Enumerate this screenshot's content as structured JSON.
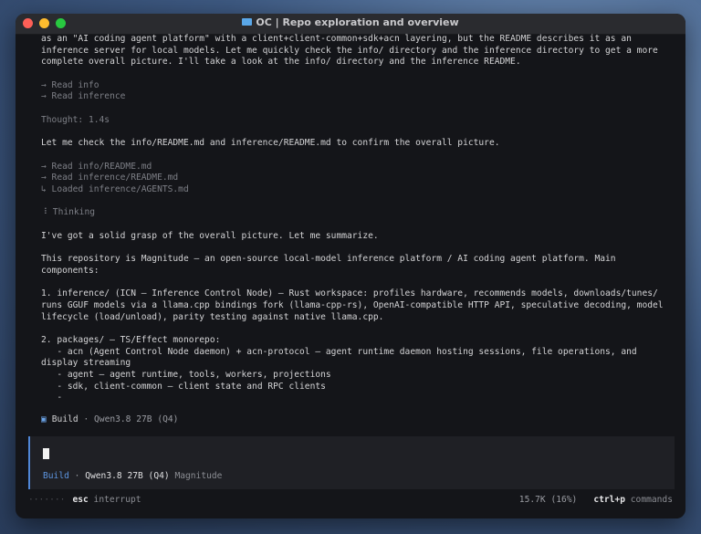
{
  "window": {
    "title": "OC | Repo exploration and overview"
  },
  "transcript": [
    {
      "text": "as an \"AI coding agent platform\" with a client+client-common+sdk+acn layering, but the README describes it as an",
      "style": "normal"
    },
    {
      "text": "inference server for local models. Let me quickly check the info/ directory and the inference directory to get a more",
      "style": "normal"
    },
    {
      "text": "complete overall picture. I'll take a look at the info/ directory and the inference README.",
      "style": "normal"
    },
    {
      "text": "",
      "style": "blank"
    },
    {
      "text": "→ Read info",
      "style": "dim"
    },
    {
      "text": "→ Read inference",
      "style": "dim"
    },
    {
      "text": "",
      "style": "blank"
    },
    {
      "text": "Thought: 1.4s",
      "style": "dim"
    },
    {
      "text": "",
      "style": "blank"
    },
    {
      "text": "Let me check the info/README.md and inference/README.md to confirm the overall picture.",
      "style": "normal"
    },
    {
      "text": "",
      "style": "blank"
    },
    {
      "text": "→ Read info/README.md",
      "style": "dim"
    },
    {
      "text": "→ Read inference/README.md",
      "style": "dim"
    },
    {
      "text": "↳ Loaded inference/AGENTS.md",
      "style": "dim"
    },
    {
      "text": "",
      "style": "blank"
    },
    {
      "text": "⠸ Thinking",
      "style": "dim"
    },
    {
      "text": "",
      "style": "blank"
    },
    {
      "text": "I've got a solid grasp of the overall picture. Let me summarize.",
      "style": "normal"
    },
    {
      "text": "",
      "style": "blank"
    },
    {
      "text": "This repository is Magnitude — an open-source local-model inference platform / AI coding agent platform. Main",
      "style": "normal"
    },
    {
      "text": "components:",
      "style": "normal"
    },
    {
      "text": "",
      "style": "blank"
    },
    {
      "text": "1. inference/ (ICN — Inference Control Node) — Rust workspace: profiles hardware, recommends models, downloads/tunes/",
      "style": "normal"
    },
    {
      "text": "runs GGUF models via a llama.cpp bindings fork (llama-cpp-rs), OpenAI-compatible HTTP API, speculative decoding, model",
      "style": "normal"
    },
    {
      "text": "lifecycle (load/unload), parity testing against native llama.cpp.",
      "style": "normal"
    },
    {
      "text": "",
      "style": "blank"
    },
    {
      "text": "2. packages/ — TS/Effect monorepo:",
      "style": "normal"
    },
    {
      "text": "   - acn (Agent Control Node daemon) + acn-protocol — agent runtime daemon hosting sessions, file operations, and",
      "style": "normal"
    },
    {
      "text": "display streaming",
      "style": "normal"
    },
    {
      "text": "   - agent — agent runtime, tools, workers, projections",
      "style": "normal"
    },
    {
      "text": "   - sdk, client-common — client state and RPC clients",
      "style": "normal"
    },
    {
      "text": "   -",
      "style": "normal"
    }
  ],
  "status": {
    "icon": "▣",
    "mode": "Build",
    "separator": "·",
    "model": "Qwen3.8 27B (Q4)"
  },
  "input": {
    "value": "",
    "mode": "Build",
    "separator": "·",
    "model": "Qwen3.8 27B (Q4)",
    "project": "Magnitude"
  },
  "footer": {
    "spinner": "·······",
    "key_esc": "esc",
    "esc_label": "interrupt",
    "tokens": "15.7K (16%)",
    "key_cmd": "ctrl+p",
    "cmd_label": "commands"
  }
}
